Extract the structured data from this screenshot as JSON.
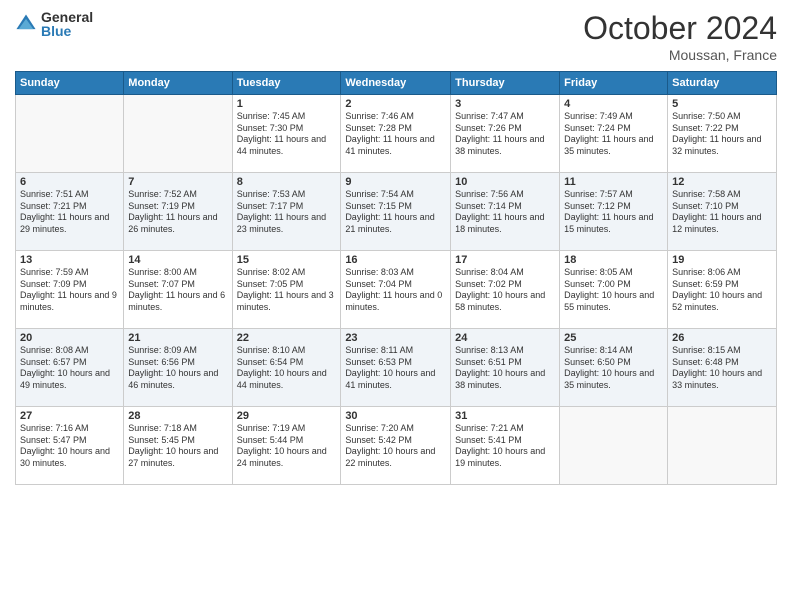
{
  "logo": {
    "general": "General",
    "blue": "Blue"
  },
  "title": "October 2024",
  "location": "Moussan, France",
  "headers": [
    "Sunday",
    "Monday",
    "Tuesday",
    "Wednesday",
    "Thursday",
    "Friday",
    "Saturday"
  ],
  "weeks": [
    [
      {
        "day": "",
        "sunrise": "",
        "sunset": "",
        "daylight": ""
      },
      {
        "day": "",
        "sunrise": "",
        "sunset": "",
        "daylight": ""
      },
      {
        "day": "1",
        "sunrise": "Sunrise: 7:45 AM",
        "sunset": "Sunset: 7:30 PM",
        "daylight": "Daylight: 11 hours and 44 minutes."
      },
      {
        "day": "2",
        "sunrise": "Sunrise: 7:46 AM",
        "sunset": "Sunset: 7:28 PM",
        "daylight": "Daylight: 11 hours and 41 minutes."
      },
      {
        "day": "3",
        "sunrise": "Sunrise: 7:47 AM",
        "sunset": "Sunset: 7:26 PM",
        "daylight": "Daylight: 11 hours and 38 minutes."
      },
      {
        "day": "4",
        "sunrise": "Sunrise: 7:49 AM",
        "sunset": "Sunset: 7:24 PM",
        "daylight": "Daylight: 11 hours and 35 minutes."
      },
      {
        "day": "5",
        "sunrise": "Sunrise: 7:50 AM",
        "sunset": "Sunset: 7:22 PM",
        "daylight": "Daylight: 11 hours and 32 minutes."
      }
    ],
    [
      {
        "day": "6",
        "sunrise": "Sunrise: 7:51 AM",
        "sunset": "Sunset: 7:21 PM",
        "daylight": "Daylight: 11 hours and 29 minutes."
      },
      {
        "day": "7",
        "sunrise": "Sunrise: 7:52 AM",
        "sunset": "Sunset: 7:19 PM",
        "daylight": "Daylight: 11 hours and 26 minutes."
      },
      {
        "day": "8",
        "sunrise": "Sunrise: 7:53 AM",
        "sunset": "Sunset: 7:17 PM",
        "daylight": "Daylight: 11 hours and 23 minutes."
      },
      {
        "day": "9",
        "sunrise": "Sunrise: 7:54 AM",
        "sunset": "Sunset: 7:15 PM",
        "daylight": "Daylight: 11 hours and 21 minutes."
      },
      {
        "day": "10",
        "sunrise": "Sunrise: 7:56 AM",
        "sunset": "Sunset: 7:14 PM",
        "daylight": "Daylight: 11 hours and 18 minutes."
      },
      {
        "day": "11",
        "sunrise": "Sunrise: 7:57 AM",
        "sunset": "Sunset: 7:12 PM",
        "daylight": "Daylight: 11 hours and 15 minutes."
      },
      {
        "day": "12",
        "sunrise": "Sunrise: 7:58 AM",
        "sunset": "Sunset: 7:10 PM",
        "daylight": "Daylight: 11 hours and 12 minutes."
      }
    ],
    [
      {
        "day": "13",
        "sunrise": "Sunrise: 7:59 AM",
        "sunset": "Sunset: 7:09 PM",
        "daylight": "Daylight: 11 hours and 9 minutes."
      },
      {
        "day": "14",
        "sunrise": "Sunrise: 8:00 AM",
        "sunset": "Sunset: 7:07 PM",
        "daylight": "Daylight: 11 hours and 6 minutes."
      },
      {
        "day": "15",
        "sunrise": "Sunrise: 8:02 AM",
        "sunset": "Sunset: 7:05 PM",
        "daylight": "Daylight: 11 hours and 3 minutes."
      },
      {
        "day": "16",
        "sunrise": "Sunrise: 8:03 AM",
        "sunset": "Sunset: 7:04 PM",
        "daylight": "Daylight: 11 hours and 0 minutes."
      },
      {
        "day": "17",
        "sunrise": "Sunrise: 8:04 AM",
        "sunset": "Sunset: 7:02 PM",
        "daylight": "Daylight: 10 hours and 58 minutes."
      },
      {
        "day": "18",
        "sunrise": "Sunrise: 8:05 AM",
        "sunset": "Sunset: 7:00 PM",
        "daylight": "Daylight: 10 hours and 55 minutes."
      },
      {
        "day": "19",
        "sunrise": "Sunrise: 8:06 AM",
        "sunset": "Sunset: 6:59 PM",
        "daylight": "Daylight: 10 hours and 52 minutes."
      }
    ],
    [
      {
        "day": "20",
        "sunrise": "Sunrise: 8:08 AM",
        "sunset": "Sunset: 6:57 PM",
        "daylight": "Daylight: 10 hours and 49 minutes."
      },
      {
        "day": "21",
        "sunrise": "Sunrise: 8:09 AM",
        "sunset": "Sunset: 6:56 PM",
        "daylight": "Daylight: 10 hours and 46 minutes."
      },
      {
        "day": "22",
        "sunrise": "Sunrise: 8:10 AM",
        "sunset": "Sunset: 6:54 PM",
        "daylight": "Daylight: 10 hours and 44 minutes."
      },
      {
        "day": "23",
        "sunrise": "Sunrise: 8:11 AM",
        "sunset": "Sunset: 6:53 PM",
        "daylight": "Daylight: 10 hours and 41 minutes."
      },
      {
        "day": "24",
        "sunrise": "Sunrise: 8:13 AM",
        "sunset": "Sunset: 6:51 PM",
        "daylight": "Daylight: 10 hours and 38 minutes."
      },
      {
        "day": "25",
        "sunrise": "Sunrise: 8:14 AM",
        "sunset": "Sunset: 6:50 PM",
        "daylight": "Daylight: 10 hours and 35 minutes."
      },
      {
        "day": "26",
        "sunrise": "Sunrise: 8:15 AM",
        "sunset": "Sunset: 6:48 PM",
        "daylight": "Daylight: 10 hours and 33 minutes."
      }
    ],
    [
      {
        "day": "27",
        "sunrise": "Sunrise: 7:16 AM",
        "sunset": "Sunset: 5:47 PM",
        "daylight": "Daylight: 10 hours and 30 minutes."
      },
      {
        "day": "28",
        "sunrise": "Sunrise: 7:18 AM",
        "sunset": "Sunset: 5:45 PM",
        "daylight": "Daylight: 10 hours and 27 minutes."
      },
      {
        "day": "29",
        "sunrise": "Sunrise: 7:19 AM",
        "sunset": "Sunset: 5:44 PM",
        "daylight": "Daylight: 10 hours and 24 minutes."
      },
      {
        "day": "30",
        "sunrise": "Sunrise: 7:20 AM",
        "sunset": "Sunset: 5:42 PM",
        "daylight": "Daylight: 10 hours and 22 minutes."
      },
      {
        "day": "31",
        "sunrise": "Sunrise: 7:21 AM",
        "sunset": "Sunset: 5:41 PM",
        "daylight": "Daylight: 10 hours and 19 minutes."
      },
      {
        "day": "",
        "sunrise": "",
        "sunset": "",
        "daylight": ""
      },
      {
        "day": "",
        "sunrise": "",
        "sunset": "",
        "daylight": ""
      }
    ]
  ]
}
